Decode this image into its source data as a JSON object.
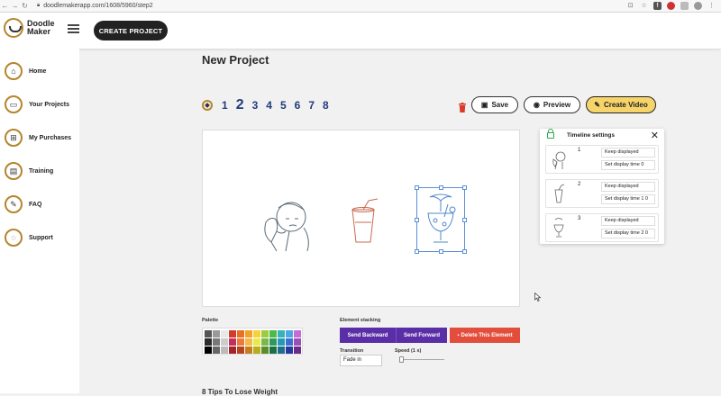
{
  "browser": {
    "url": "doodlemakerapp.com/1608/5960/step2"
  },
  "header": {
    "logo_line1": "Doodle",
    "logo_line2": "Maker",
    "create_project": "CREATE PROJECT"
  },
  "sidebar": {
    "items": [
      {
        "label": "Home",
        "icon": "home-icon"
      },
      {
        "label": "Your Projects",
        "icon": "folder-icon"
      },
      {
        "label": "My Purchases",
        "icon": "cart-icon"
      },
      {
        "label": "Training",
        "icon": "training-icon"
      },
      {
        "label": "FAQ",
        "icon": "pen-icon"
      },
      {
        "label": "Support",
        "icon": "chat-icon"
      }
    ]
  },
  "main": {
    "title": "New Project",
    "steps": [
      "1",
      "2",
      "3",
      "4",
      "5",
      "6",
      "7",
      "8"
    ],
    "active_step": "2",
    "save_label": "Save",
    "preview_label": "Preview",
    "create_video_label": "Create Video",
    "next_heading": "8 Tips To Lose Weight"
  },
  "palette": {
    "label": "Palette",
    "colors": [
      "#555555",
      "#999999",
      "#e8e8e8",
      "#d23a2a",
      "#e86f23",
      "#f0a22c",
      "#f6d23d",
      "#9ccc3c",
      "#4fb949",
      "#35b3b8",
      "#4aa7e3",
      "#c46bd8",
      "#2b2b2b",
      "#777777",
      "#cccccc",
      "#c22f5a",
      "#ea7b3b",
      "#f5b84a",
      "#e9e94c",
      "#79b84a",
      "#2c9a5a",
      "#2699b6",
      "#3b6fd0",
      "#9a4fb6",
      "#000000",
      "#666666",
      "#bbbbbb",
      "#a3232b",
      "#b54320",
      "#c77d1c",
      "#b8ad1e",
      "#5a8c2b",
      "#1c6f43",
      "#1f6c8c",
      "#233a9a",
      "#6a2c8a"
    ]
  },
  "stacking": {
    "label": "Element stacking",
    "send_backward": "Send Backward",
    "send_forward": "Send Forward",
    "delete": "Delete This Element"
  },
  "transition": {
    "label": "Transition",
    "value": "Fade in"
  },
  "speed": {
    "label": "Speed (1 s)",
    "level": 0.04
  },
  "timeline": {
    "title": "Timeline settings",
    "rows": [
      {
        "num": "1",
        "keep": "Keep displayed",
        "time": "Set display time 0"
      },
      {
        "num": "2",
        "keep": "Keep displayed",
        "time": "Set display time 1 0"
      },
      {
        "num": "3",
        "keep": "Keep displayed",
        "time": "Set display time 2 0"
      }
    ]
  },
  "colors": {
    "accent_gold": "#b5852c",
    "navy_steps": "#233a7a",
    "purple": "#5a2ea6",
    "delete_red": "#e34d3b",
    "create_video_yellow": "#f7d46a"
  }
}
